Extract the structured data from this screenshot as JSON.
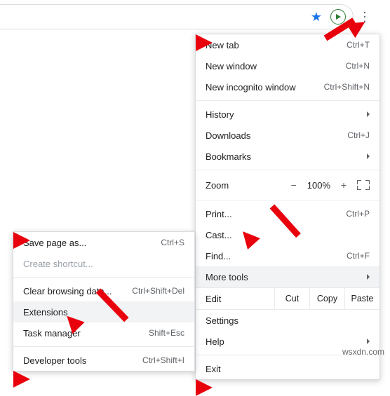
{
  "toolbar": {
    "star_tooltip": "Bookmark this page"
  },
  "menu": {
    "new_tab": "New tab",
    "new_tab_sc": "Ctrl+T",
    "new_window": "New window",
    "new_window_sc": "Ctrl+N",
    "incognito": "New incognito window",
    "incognito_sc": "Ctrl+Shift+N",
    "history": "History",
    "downloads": "Downloads",
    "downloads_sc": "Ctrl+J",
    "bookmarks": "Bookmarks",
    "zoom_label": "Zoom",
    "zoom_minus": "−",
    "zoom_value": "100%",
    "zoom_plus": "+",
    "print": "Print...",
    "print_sc": "Ctrl+P",
    "cast": "Cast...",
    "find": "Find...",
    "find_sc": "Ctrl+F",
    "more_tools": "More tools",
    "edit_label": "Edit",
    "cut": "Cut",
    "copy": "Copy",
    "paste": "Paste",
    "settings": "Settings",
    "help": "Help",
    "exit": "Exit"
  },
  "submenu": {
    "save_page": "Save page as...",
    "save_page_sc": "Ctrl+S",
    "create_shortcut": "Create shortcut...",
    "clear_data": "Clear browsing data...",
    "clear_data_sc": "Ctrl+Shift+Del",
    "extensions": "Extensions",
    "task_manager": "Task manager",
    "task_manager_sc": "Shift+Esc",
    "dev_tools": "Developer tools",
    "dev_tools_sc": "Ctrl+Shift+I"
  },
  "watermark": "wsxdn.com"
}
